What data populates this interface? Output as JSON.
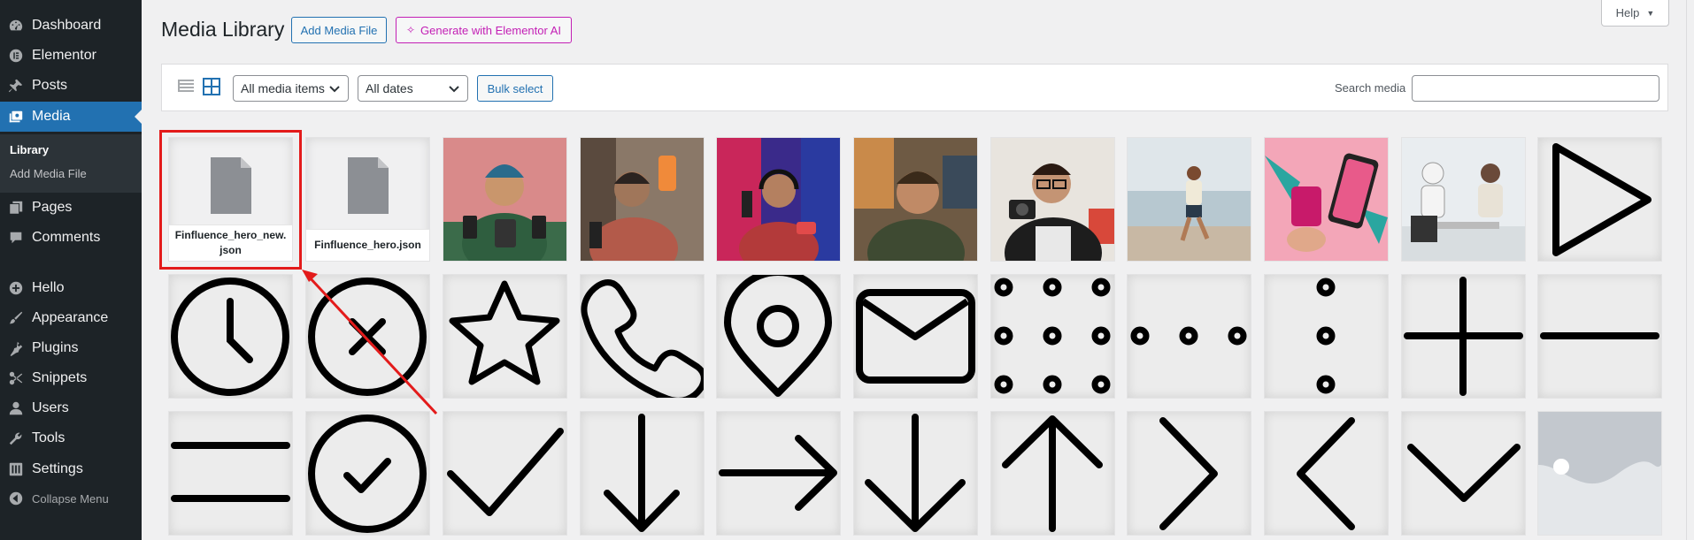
{
  "sidebar": {
    "items": [
      {
        "label": "Dashboard",
        "icon": "dashboard-icon"
      },
      {
        "label": "Elementor",
        "icon": "elementor-icon"
      },
      {
        "label": "Posts",
        "icon": "pin-icon"
      },
      {
        "label": "Media",
        "icon": "media-icon"
      },
      {
        "label": "Pages",
        "icon": "pages-icon"
      },
      {
        "label": "Comments",
        "icon": "comments-icon"
      },
      {
        "label": "Hello",
        "icon": "plus-circle-icon"
      },
      {
        "label": "Appearance",
        "icon": "brush-icon"
      },
      {
        "label": "Plugins",
        "icon": "plug-icon"
      },
      {
        "label": "Snippets",
        "icon": "scissors-icon"
      },
      {
        "label": "Users",
        "icon": "user-icon"
      },
      {
        "label": "Tools",
        "icon": "wrench-icon"
      },
      {
        "label": "Settings",
        "icon": "settings-icon"
      }
    ],
    "submenu": {
      "library": "Library",
      "add_media": "Add Media File"
    },
    "collapse": "Collapse Menu"
  },
  "header": {
    "title": "Media Library",
    "add_media_button": "Add Media File",
    "ai_button": "Generate with Elementor AI",
    "help": "Help"
  },
  "toolbar": {
    "type_filter": "All media items",
    "date_filter": "All dates",
    "bulk_select": "Bulk select",
    "search_label": "Search media",
    "search_value": ""
  },
  "files": [
    {
      "name": "Finfluence_hero_new.json"
    },
    {
      "name": "Finfluence_hero.json"
    }
  ],
  "colors": {
    "sidebar_bg": "#1d2327",
    "accent": "#2271b1",
    "ai_accent": "#c31fb5",
    "highlight": "#e31b1b"
  }
}
